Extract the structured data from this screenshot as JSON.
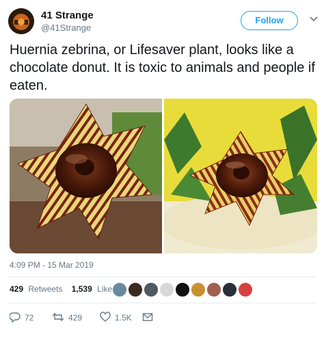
{
  "author": {
    "name": "41 Strange",
    "handle": "@41Strange",
    "follow_label": "Follow"
  },
  "tweet": {
    "text": "Huernia zebrina, or Lifesaver plant, looks like a chocolate donut. It is toxic to animals and people if eaten.",
    "timestamp": "4:09 PM - 15 Mar 2019"
  },
  "stats": {
    "retweets_count": "429",
    "retweets_label": "Retweets",
    "likes_count": "1,539",
    "likes_label": "Likes"
  },
  "actions": {
    "replies": "72",
    "retweets": "429",
    "likes": "1.5K"
  },
  "colors": {
    "accent": "#1da1f2",
    "secondary_text": "#657786"
  },
  "icons": [
    "reply-icon",
    "retweet-icon",
    "like-icon",
    "message-icon",
    "chevron-down-icon"
  ]
}
